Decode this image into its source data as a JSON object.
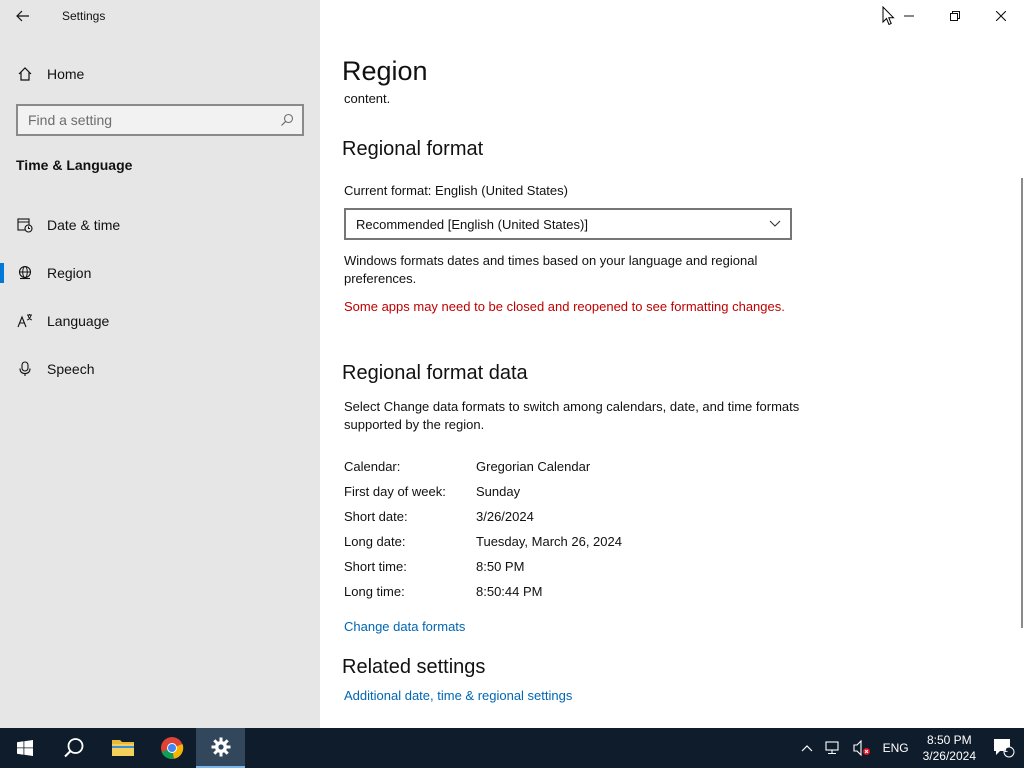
{
  "window": {
    "title": "Settings"
  },
  "sidebar": {
    "home_label": "Home",
    "search_placeholder": "Find a setting",
    "section_title": "Time & Language",
    "items": [
      {
        "label": "Date & time",
        "icon": "calendar-clock-icon"
      },
      {
        "label": "Region",
        "icon": "globe-icon",
        "selected": true
      },
      {
        "label": "Language",
        "icon": "language-icon"
      },
      {
        "label": "Speech",
        "icon": "microphone-icon"
      }
    ]
  },
  "main": {
    "page_title": "Region",
    "cut_text": "content.",
    "regional_format": {
      "heading": "Regional format",
      "current_format": "Current format: English (United States)",
      "dropdown_value": "Recommended [English (United States)]",
      "description": "Windows formats dates and times based on your language and regional preferences.",
      "warning": "Some apps may need to be closed and reopened to see formatting changes."
    },
    "format_data": {
      "heading": "Regional format data",
      "description": "Select Change data formats to switch among calendars, date, and time formats supported by the region.",
      "rows": [
        {
          "key": "Calendar:",
          "value": "Gregorian Calendar"
        },
        {
          "key": "First day of week:",
          "value": "Sunday"
        },
        {
          "key": "Short date:",
          "value": "3/26/2024"
        },
        {
          "key": "Long date:",
          "value": "Tuesday, March 26, 2024"
        },
        {
          "key": "Short time:",
          "value": "8:50 PM"
        },
        {
          "key": "Long time:",
          "value": "8:50:44 PM"
        }
      ],
      "change_link": "Change data formats"
    },
    "related": {
      "heading": "Related settings",
      "link": "Additional date, time & regional settings"
    }
  },
  "taskbar": {
    "tray": {
      "language": "ENG",
      "time": "8:50 PM",
      "date": "3/26/2024",
      "notification_count": "1"
    }
  },
  "colors": {
    "accent": "#0078d7",
    "link": "#0066b4",
    "warning": "#c00000",
    "sidebar_bg": "#e6e6e6",
    "taskbar_bg": "#0f1c2b"
  }
}
